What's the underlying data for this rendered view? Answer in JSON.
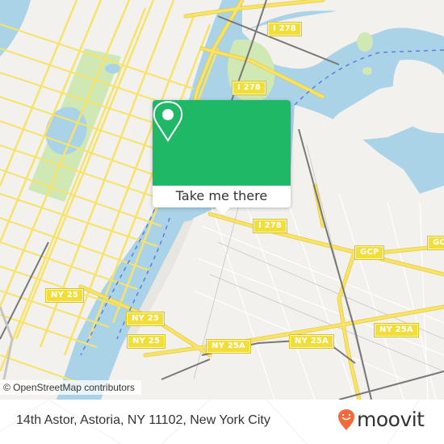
{
  "map": {
    "colors": {
      "land": "#f2f1ee",
      "water": "#aad3e8",
      "park": "#cfe8b4",
      "road": "#f7e36a",
      "road_edge": "#e8cc3a",
      "minor_road": "#ffffff",
      "rail": "#777777",
      "ferry": "#5b7fe0"
    },
    "shields": [
      {
        "label": "I 278",
        "id": "i278-north"
      },
      {
        "label": "I 278",
        "id": "i278-middle"
      },
      {
        "label": "I 278",
        "id": "i278-south"
      },
      {
        "label": "GCP",
        "id": "gcp-west"
      },
      {
        "label": "GCP",
        "id": "gcp-east"
      },
      {
        "label": "NY 25",
        "id": "ny25-west"
      },
      {
        "label": "NY 25",
        "id": "ny25-middle"
      },
      {
        "label": "NY 25",
        "id": "ny25-south"
      },
      {
        "label": "NY 25A",
        "id": "ny25a-west"
      },
      {
        "label": "NY 25A",
        "id": "ny25a-middle"
      },
      {
        "label": "NY 25A",
        "id": "ny25a-east"
      }
    ],
    "attribution": "© OpenStreetMap contributors"
  },
  "popup": {
    "icon": "map-pin-icon",
    "button_label": "Take me there",
    "accent": "#1fb866"
  },
  "footer": {
    "address": "14th Astor, Astoria, NY 11102, New York City",
    "brand": "moovit",
    "brand_color": "#f26b3a"
  }
}
